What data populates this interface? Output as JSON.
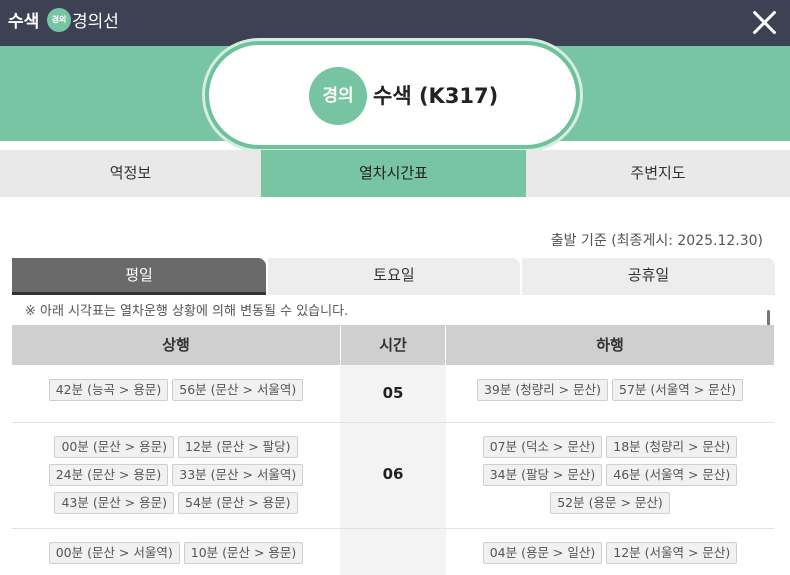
{
  "header": {
    "station": "수색",
    "line_badge": "경의",
    "line_name": "경의선"
  },
  "station_card": {
    "badge": "경의",
    "name": "수색 (K317)"
  },
  "tabs": [
    {
      "label": "역정보"
    },
    {
      "label": "열차시간표"
    },
    {
      "label": "주변지도"
    }
  ],
  "basis": "출발 기준 (최종게시: 2025.12.30)",
  "day_tabs": [
    {
      "label": "평일"
    },
    {
      "label": "토요일"
    },
    {
      "label": "공휴일"
    }
  ],
  "notice": "※ 아래 시각표는 열차운행 상황에 의해 변동될 수 있습니다.",
  "table": {
    "headers": {
      "up": "상행",
      "hour": "시간",
      "down": "하행"
    },
    "rows": [
      {
        "hour": "05",
        "up": [
          "42분 (능곡 > 용문)",
          "56분 (문산 > 서울역)"
        ],
        "down": [
          "39분 (청량리 > 문산)",
          "57분 (서울역 > 문산)"
        ]
      },
      {
        "hour": "06",
        "up": [
          "00분 (문산 > 용문)",
          "12분 (문산 > 팔당)",
          "24분 (문산 > 용문)",
          "33분 (문산 > 서울역)",
          "43분 (문산 > 용문)",
          "54분 (문산 > 용문)"
        ],
        "down": [
          "07분 (덕소 > 문산)",
          "18분 (청량리 > 문산)",
          "34분 (팔당 > 문산)",
          "46분 (서울역 > 문산)",
          "52분 (용문 > 문산)"
        ]
      },
      {
        "hour": "",
        "up": [
          "00분 (문산 > 서울역)",
          "10분 (문산 > 용문)"
        ],
        "down": [
          "04분 (용문 > 일산)",
          "12분 (서울역 > 문산)"
        ]
      }
    ]
  }
}
